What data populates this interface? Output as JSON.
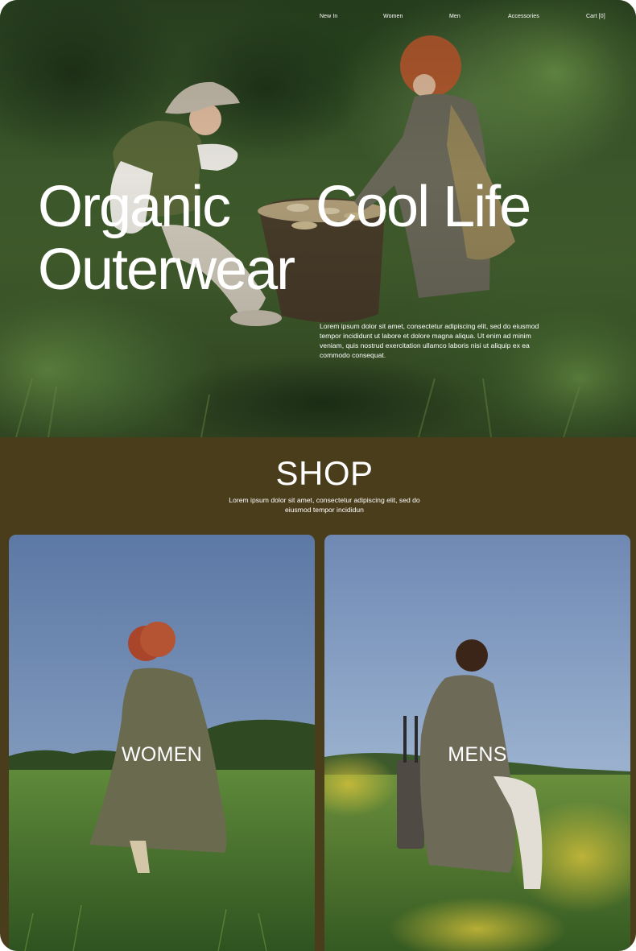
{
  "nav": {
    "items": [
      {
        "label": "New In"
      },
      {
        "label": "Women"
      },
      {
        "label": "Men"
      },
      {
        "label": "Accessories"
      },
      {
        "label": "Cart [0]"
      }
    ]
  },
  "hero": {
    "title_word_1": "Organic",
    "title_word_2": "Cool Life",
    "title_word_3": "Outerwear",
    "description": "Lorem ipsum dolor sit amet, consectetur adipiscing elit, sed do eiusmod tempor incididunt ut labore et dolore magna aliqua. Ut enim ad minim veniam, quis nostrud exercitation ullamco laboris nisi ut aliquip ex ea commodo consequat."
  },
  "shop": {
    "title": "SHOP",
    "description": "Lorem ipsum dolor sit amet, consectetur adipiscing elit, sed do eiusmod tempor incididun",
    "categories": [
      {
        "label": "WOMEN"
      },
      {
        "label": "MENS"
      }
    ]
  },
  "colors": {
    "shop_background": "#4a3d1b",
    "text": "#ffffff",
    "foliage_dark": "#2f4a24",
    "sky": "#6f8bb0"
  },
  "icons": []
}
